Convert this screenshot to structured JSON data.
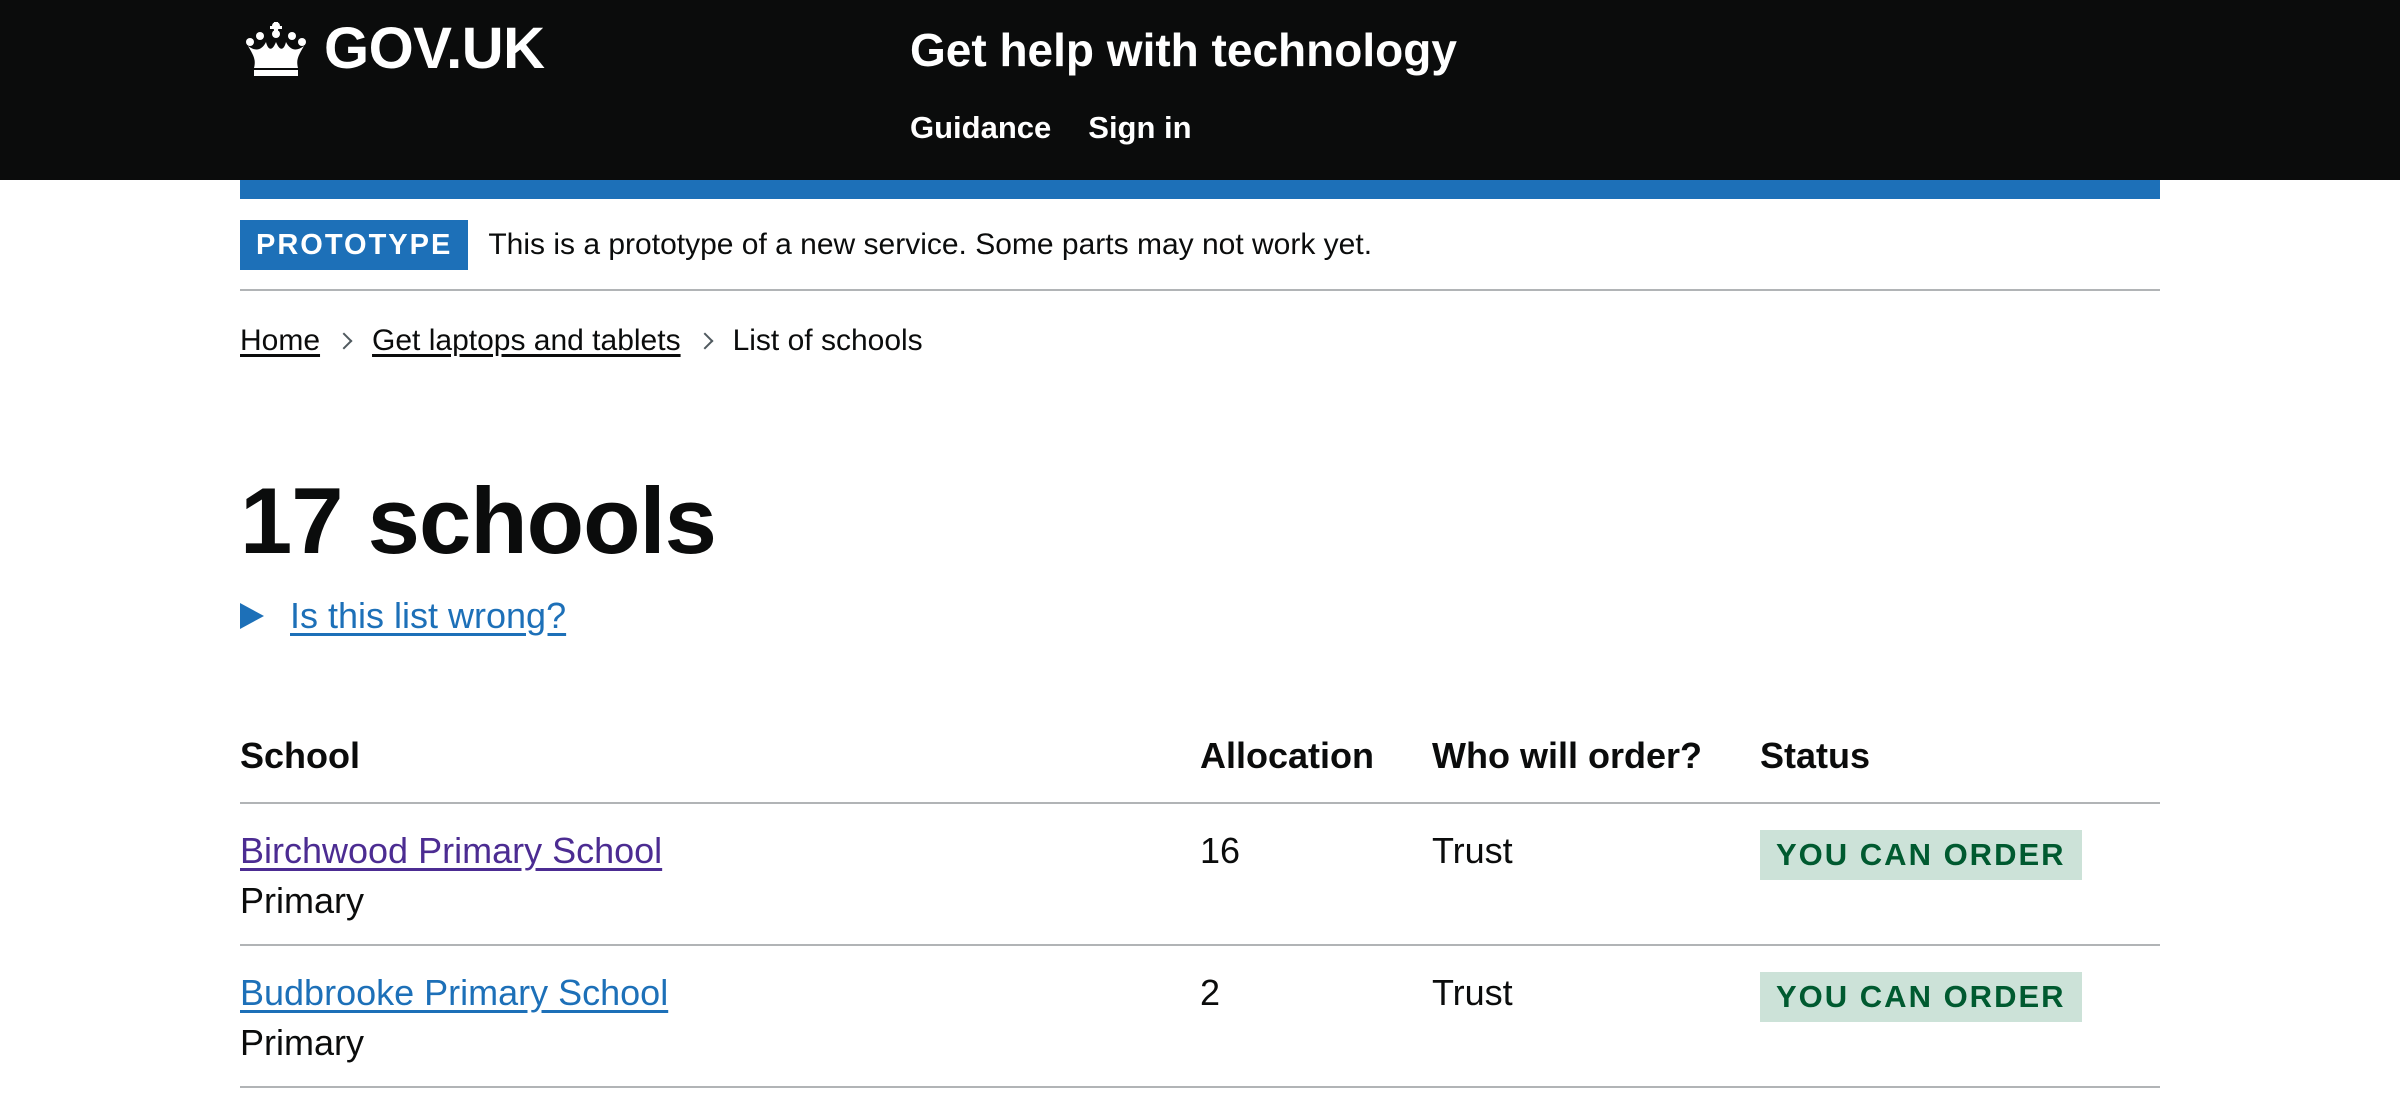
{
  "header": {
    "logo_text": "GOV.UK",
    "service_name": "Get help with technology",
    "nav": [
      {
        "label": "Guidance"
      },
      {
        "label": "Sign in"
      }
    ]
  },
  "phase_banner": {
    "tag": "PROTOTYPE",
    "text": "This is a prototype of a new service. Some parts may not work yet."
  },
  "breadcrumbs": {
    "items": [
      {
        "label": "Home"
      },
      {
        "label": "Get laptops and tablets"
      }
    ],
    "current": "List of schools"
  },
  "page": {
    "title": "17 schools",
    "details_summary": "Is this list wrong?"
  },
  "table": {
    "headers": {
      "school": "School",
      "allocation": "Allocation",
      "who": "Who will order?",
      "status": "Status"
    },
    "rows": [
      {
        "name": "Birchwood Primary School",
        "type": "Primary",
        "allocation": "16",
        "who": "Trust",
        "status": "YOU CAN ORDER"
      },
      {
        "name": "Budbrooke Primary School",
        "type": "Primary",
        "allocation": "2",
        "who": "Trust",
        "status": "YOU CAN ORDER"
      }
    ]
  },
  "colors": {
    "header_bg": "#0b0c0c",
    "brand_blue": "#1d70b8",
    "visited_link": "#4c2c92",
    "status_tag_bg": "#cce2d8",
    "status_tag_text": "#005a30",
    "border_grey": "#b1b4b6"
  },
  "icons": {
    "logo": "crown-icon",
    "breadcrumb_separator": "chevron-right-icon",
    "details_toggle": "triangle-right-icon"
  }
}
